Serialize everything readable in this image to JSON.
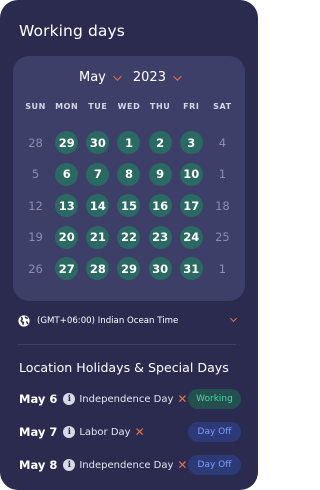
{
  "page_title": "Working days",
  "calendar": {
    "month": "May",
    "year": "2023",
    "weekdays": [
      "SUN",
      "MON",
      "TUE",
      "WED",
      "THU",
      "FRI",
      "SAT"
    ],
    "weeks": [
      [
        "28",
        "29",
        "30",
        "1",
        "2",
        "3",
        "4"
      ],
      [
        "5",
        "6",
        "7",
        "8",
        "9",
        "10",
        "1"
      ],
      [
        "12",
        "13",
        "14",
        "15",
        "16",
        "17",
        "18"
      ],
      [
        "19",
        "20",
        "21",
        "22",
        "23",
        "24",
        "25"
      ],
      [
        "26",
        "27",
        "28",
        "29",
        "30",
        "31",
        "1"
      ]
    ],
    "working_day_columns": [
      1,
      2,
      3,
      4,
      5
    ],
    "working_color": "#2a6a63"
  },
  "timezone": {
    "label": "(GMT+06:00) Indian Ocean Time",
    "icon": "globe-icon"
  },
  "holidays": {
    "title": "Location Holidays & Special Days",
    "items": [
      {
        "date": "May 6",
        "name": "Independence Day",
        "status": "Working"
      },
      {
        "date": "May 7",
        "name": "Labor Day",
        "status": "Day Off"
      },
      {
        "date": "May 8",
        "name": "Independence Day",
        "status": "Day Off"
      }
    ]
  },
  "colors": {
    "background": "#2a2b4f",
    "card": "#3d3f69",
    "accent": "#e2734c",
    "working_text": "#4bd6a5",
    "dayoff_text": "#7f9cff"
  }
}
